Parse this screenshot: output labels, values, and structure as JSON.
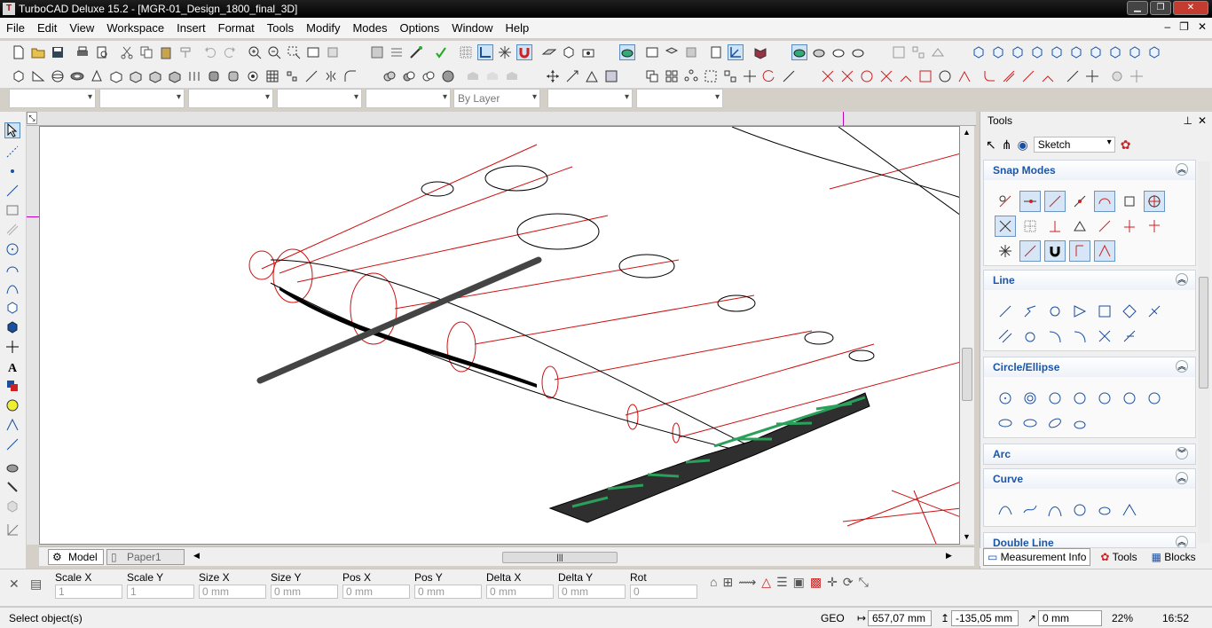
{
  "window": {
    "title": "TurboCAD Deluxe 15.2 - [MGR-01_Design_1800_final_3D]"
  },
  "menu": [
    "File",
    "Edit",
    "View",
    "Workspace",
    "Insert",
    "Format",
    "Tools",
    "Modify",
    "Modes",
    "Options",
    "Window",
    "Help"
  ],
  "property_bar": {
    "layer_value": "By Layer"
  },
  "sheets": {
    "model": "Model",
    "paper": "Paper1"
  },
  "panel": {
    "title": "Tools",
    "mode_select": "Sketch",
    "sections": [
      "Snap Modes",
      "Line",
      "Circle/Ellipse",
      "Arc",
      "Curve",
      "Double Line"
    ],
    "tabs": [
      "Measurement Info",
      "Tools",
      "Blocks"
    ]
  },
  "inspector": {
    "fields": [
      {
        "label": "Scale X",
        "value": "1"
      },
      {
        "label": "Scale Y",
        "value": "1"
      },
      {
        "label": "Size X",
        "value": "0 mm"
      },
      {
        "label": "Size Y",
        "value": "0 mm"
      },
      {
        "label": "Pos X",
        "value": "0 mm"
      },
      {
        "label": "Pos Y",
        "value": "0 mm"
      },
      {
        "label": "Delta X",
        "value": "0 mm"
      },
      {
        "label": "Delta Y",
        "value": "0 mm"
      },
      {
        "label": "Rot",
        "value": "0"
      }
    ]
  },
  "status": {
    "message": "Select object(s)",
    "geo": "GEO",
    "x": "657,07 mm",
    "y": "-135,05 mm",
    "z": "0 mm",
    "zoom": "22%",
    "time": "16:52"
  },
  "colors": {
    "accent": "#1c55a5",
    "drawing_red": "#cc1111",
    "truss_green": "#2aa05a"
  }
}
